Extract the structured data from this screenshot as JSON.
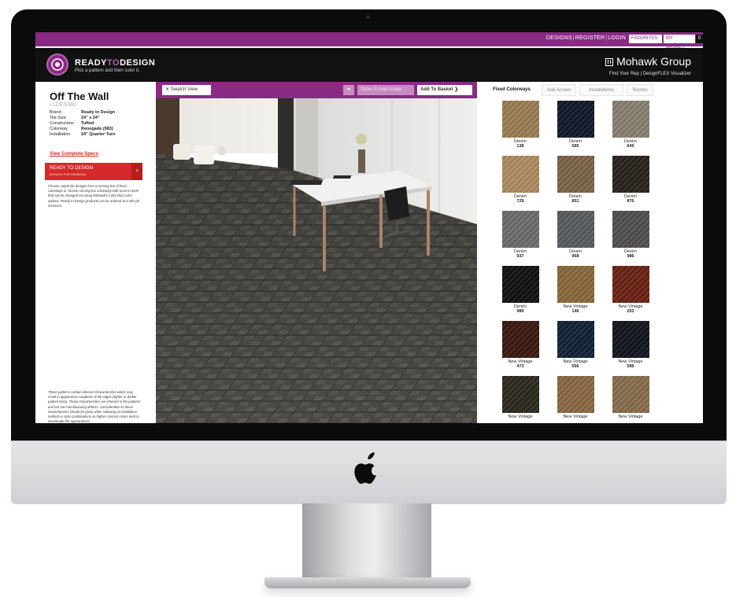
{
  "topnav": {
    "designs": "DESIGNS",
    "register": "REGISTER",
    "login": "LOGIN",
    "favorites": "FAVORITES",
    "basket": "MY BASKET",
    "basket_count": "0"
  },
  "header": {
    "logo_ready": "READY",
    "logo_to": "TO",
    "logo_design": "DESIGN",
    "tagline": "Pick a pattern and then color it.",
    "brand": "Mohawk Group",
    "links": "Find Your Rep | DesignFLEX Visualizer"
  },
  "product": {
    "name": "Off The Wall",
    "code": "L1DES340",
    "specs": [
      {
        "label": "Brand",
        "value": "Ready to Design"
      },
      {
        "label": "Tile Size",
        "value": "24\" x 24\""
      },
      {
        "label": "Construction",
        "value": "Tufted"
      },
      {
        "label": "Colorway",
        "value": "Renegade (983)"
      },
      {
        "label": "Installation",
        "value": "24\" Quarter Turn"
      }
    ],
    "spec_link": "View Complete Specs",
    "red_title": "READY TO DESIGN",
    "red_sub": "(DESIGN FOR MINIMUM)",
    "red_plus": "+",
    "description": "Choose carpet tile designs from a running line of fixed colorways or choose running line colorways with accent colors that can be changed out using Mohawk's Color Boot color options. Ready to Design products can be ordered at a 200 yd² minimum.",
    "disclaimer": "These patterns contain inherent characteristics which may result in appearance variations at tile edges (lighter or darker pattern lines). These characteristics are inherent in the patterns and are not manufacturing defects. Consideration to these characteristics should be given when selecting an installation method or color combinations as higher contrast colors tend to accentuate the appearances."
  },
  "toolbar": {
    "swatch_view": "Swatch View",
    "star": "★",
    "email": "Order E-mail Image",
    "add_basket": "Add To Basket"
  },
  "tabs": [
    "Fixed Colorways",
    "Add Accent",
    "Installations",
    "Rooms"
  ],
  "swatches": [
    {
      "name": "Denim",
      "num": "138",
      "color": "#9c7f56"
    },
    {
      "name": "Denim",
      "num": "585",
      "color": "#121a2a"
    },
    {
      "name": "Denim",
      "num": "649",
      "color": "#8a8272"
    },
    {
      "name": "Denim",
      "num": "729",
      "color": "#b08d62"
    },
    {
      "name": "Denim",
      "num": "851",
      "color": "#7d6549"
    },
    {
      "name": "Denim",
      "num": "876",
      "color": "#2a241d"
    },
    {
      "name": "Denim",
      "num": "937",
      "color": "#6d6e6d"
    },
    {
      "name": "Denim",
      "num": "968",
      "color": "#595d61"
    },
    {
      "name": "Denim",
      "num": "986",
      "color": "#535050"
    },
    {
      "name": "Denim",
      "num": "989",
      "color": "#121212"
    },
    {
      "name": "New Vintage",
      "num": "146",
      "color": "#8a6b3c"
    },
    {
      "name": "New Vintage",
      "num": "253",
      "color": "#6b2416"
    },
    {
      "name": "New Vintage",
      "num": "473",
      "color": "#3b1a12"
    },
    {
      "name": "New Vintage",
      "num": "566",
      "color": "#122438"
    },
    {
      "name": "New Vintage",
      "num": "589",
      "color": "#14171f"
    },
    {
      "name": "New Vintage",
      "num": "",
      "color": "#2c2a20"
    },
    {
      "name": "New Vintage",
      "num": "",
      "color": "#8c6a45"
    },
    {
      "name": "New Vintage",
      "num": "",
      "color": "#8a6f4e"
    }
  ],
  "colors": {
    "brand_purple": "#8b2a83",
    "accent_red": "#d62a2a",
    "header_black": "#111111"
  }
}
